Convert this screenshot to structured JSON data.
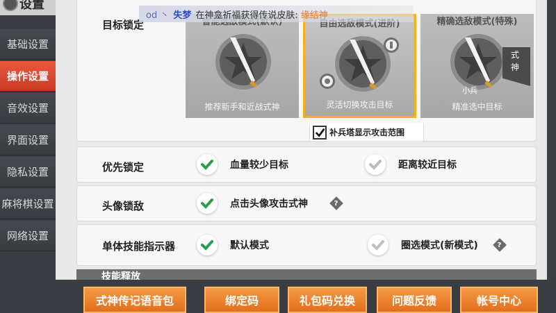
{
  "window": {
    "title": "设置"
  },
  "sidebar": {
    "items": [
      {
        "label": "基础设置",
        "active": false
      },
      {
        "label": "操作设置",
        "active": true
      },
      {
        "label": "音效设置",
        "active": false
      },
      {
        "label": "界面设置",
        "active": false
      },
      {
        "label": "隐私设置",
        "active": false
      },
      {
        "label": "麻将棋设置",
        "active": false
      },
      {
        "label": "网络设置",
        "active": false
      }
    ]
  },
  "notification": {
    "prefix": "od 丶",
    "name": "失梦",
    "text": "在神龛祈福获得传说皮肤:",
    "skin": "缘结神"
  },
  "target_lock": {
    "label": "目标锁定",
    "cards": [
      {
        "title": "智能选敌模式(默认)",
        "desc": "推荐新手和近战式神",
        "selected": false,
        "icon": "sword-star-icon"
      },
      {
        "title": "自由选敌模式(进阶)",
        "desc": "灵活切换攻击目标",
        "selected": true,
        "icon": "sword-star-icon"
      },
      {
        "title": "精确选敌模式(特殊)",
        "desc": "精准选中目标",
        "selected": false,
        "icon": "sword-star-icon",
        "tags": [
          "式",
          "神",
          "小兵"
        ]
      }
    ],
    "tower_range": {
      "label": "补兵塔显示攻击范围",
      "checked": true
    }
  },
  "priority_lock": {
    "label": "优先锁定",
    "options": [
      {
        "label": "血量较少目标",
        "selected": true
      },
      {
        "label": "距离较近目标",
        "selected": false
      }
    ]
  },
  "avatar_lock": {
    "label": "头像锁敌",
    "options": [
      {
        "label": "点击头像攻击式神",
        "selected": true
      }
    ]
  },
  "skill_indicator": {
    "label": "单体技能指示器",
    "options": [
      {
        "label": "默认模式",
        "selected": true
      },
      {
        "label": "圈选模式(新模式)",
        "selected": false
      }
    ]
  },
  "next_section": {
    "label": "技能释放"
  },
  "bottom_buttons": [
    {
      "label": "式神传记语音包"
    },
    {
      "label": "绑定码"
    },
    {
      "label": "礼包码兑换"
    },
    {
      "label": "问题反馈"
    },
    {
      "label": "帐号中心"
    }
  ],
  "colors": {
    "accent_active": "#e0472f",
    "card_selected_border": "#f2b316",
    "check_on": "#2a9d4a",
    "check_off": "#bdbdbd",
    "button_orange": "#ec8232"
  }
}
